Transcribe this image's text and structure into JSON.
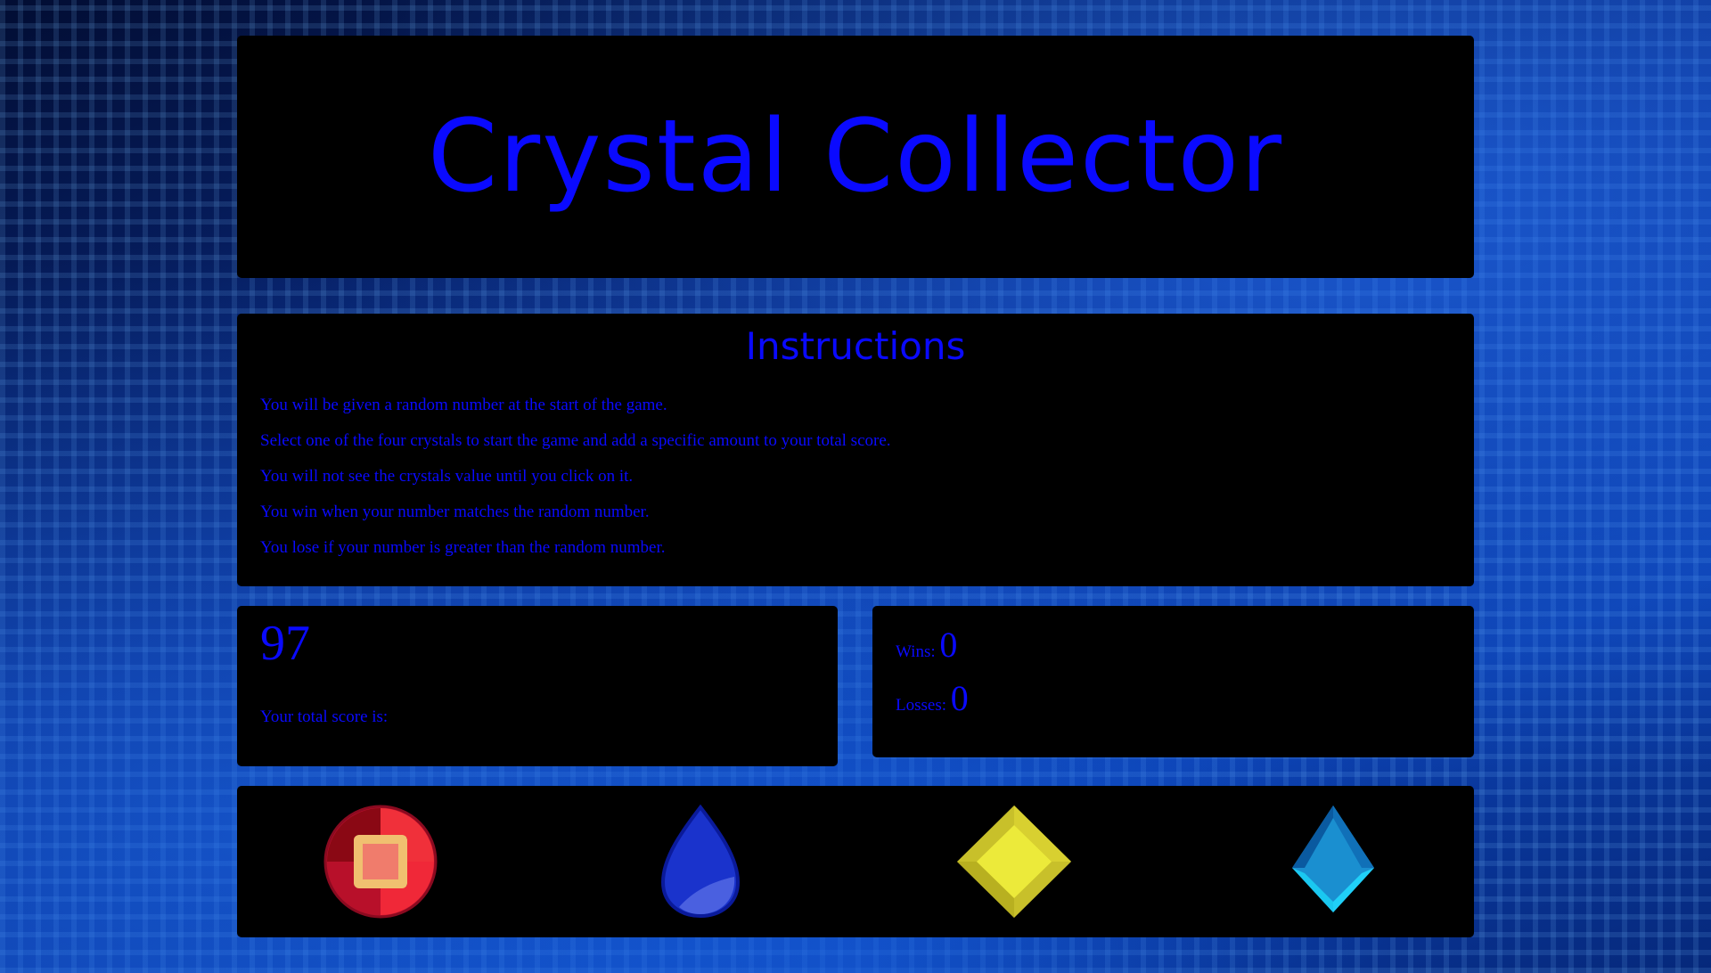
{
  "header": {
    "title": "Crystal Collector"
  },
  "instructions": {
    "heading": "Instructions",
    "items": [
      "You will be given a random number at the start of the game.",
      "Select one of the four crystals to start the game and add a specific amount to your total score.",
      "You will not see the crystals value until you click on it.",
      "You win when your number matches the random number.",
      "You lose if your number is greater than the random number."
    ]
  },
  "score": {
    "target_number": "97",
    "total_label": "Your total score is:"
  },
  "stats": {
    "wins_label": "Wins:",
    "wins_value": "0",
    "losses_label": "Losses:",
    "losses_value": "0"
  },
  "crystals": [
    {
      "name": "red-gem",
      "color": "#e0202c"
    },
    {
      "name": "blue-drop",
      "color": "#1a33cc"
    },
    {
      "name": "yellow-diamond",
      "color": "#e8e032"
    },
    {
      "name": "cyan-crystal",
      "color": "#1a8fd0"
    }
  ],
  "colors": {
    "text": "#0a0aff",
    "panel": "#000000"
  }
}
